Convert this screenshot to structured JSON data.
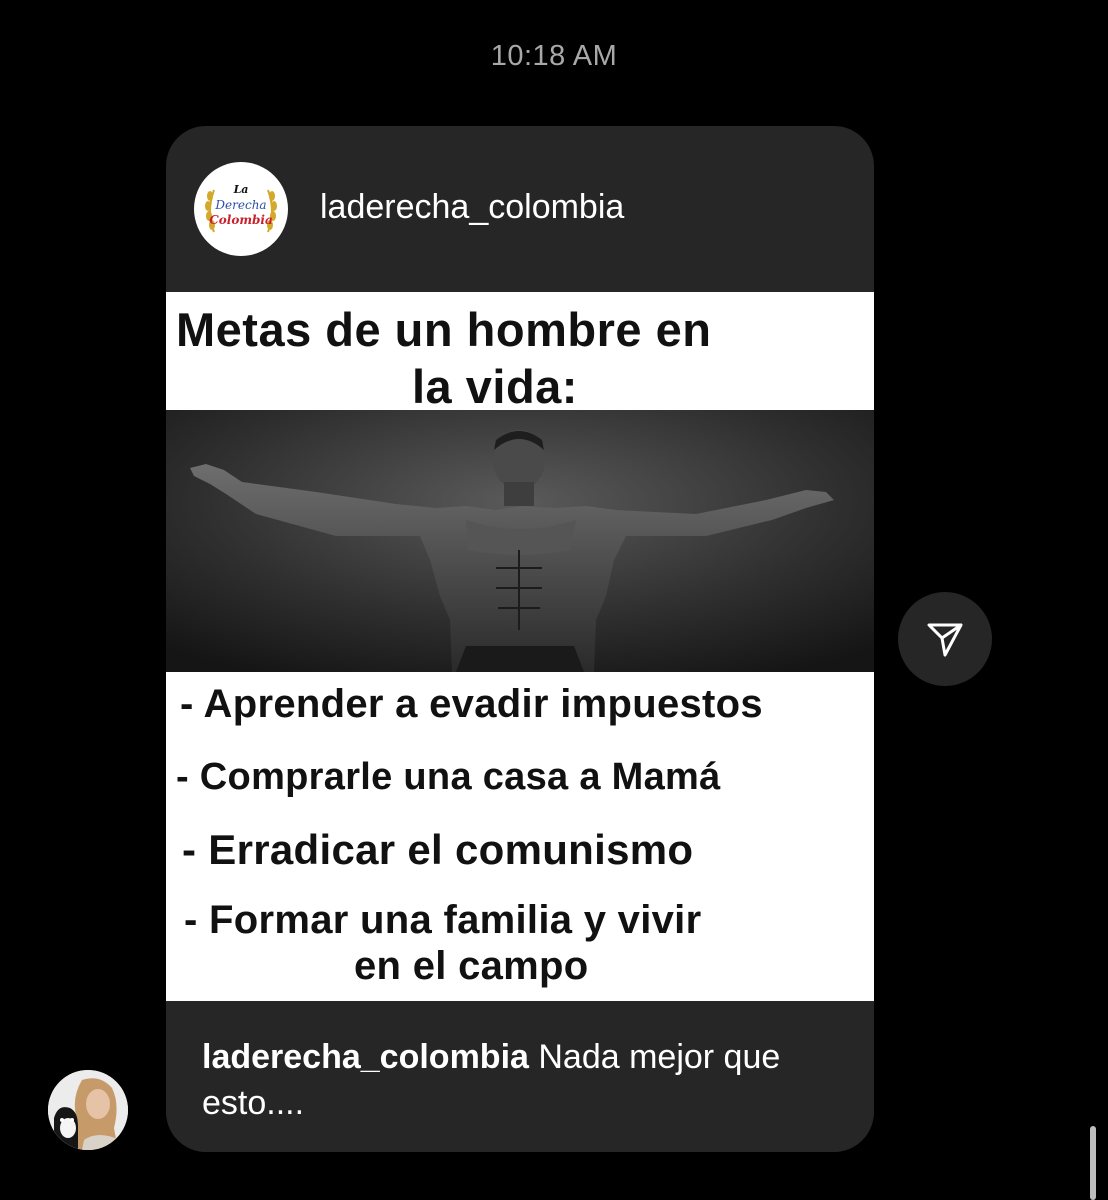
{
  "timestamp": "10:18 AM",
  "post": {
    "author": "laderecha_colombia",
    "logo_text": {
      "line1": "La",
      "line2": "Derecha",
      "line3": "Colombia"
    },
    "meme": {
      "title_line1": "Metas de un hombre en",
      "title_line2": "la vida:",
      "goals": [
        "- Aprender a evadir impuestos",
        "- Comprarle una casa a Mamá",
        "- Erradicar el comunismo",
        "- Formar una familia y vivir",
        "en el campo"
      ]
    },
    "caption": {
      "username": "laderecha_colombia",
      "text": " Nada mejor que esto...."
    }
  },
  "icons": {
    "share": "share-icon",
    "sender_avatar": "avatar"
  },
  "colors": {
    "background": "#000000",
    "card": "#262626",
    "timestamp": "#a8a8a8",
    "logo_blue": "#2b4ea8",
    "logo_red": "#c8202c",
    "logo_gold": "#d4a82a"
  }
}
